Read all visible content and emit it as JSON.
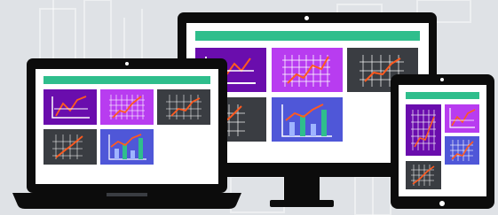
{
  "colors": {
    "background": "#dfe2e6",
    "frame": "#0c0c0c",
    "screen": "#ffffff",
    "header": "#2fbe8c",
    "tile_purple": "#6a0dad",
    "tile_magenta": "#b83cf0",
    "tile_dark": "#3a3d42",
    "tile_blue": "#4f57d8",
    "chart_line": "#ff5a1f",
    "chart_grid": "#ffffff",
    "bar_green": "#2fbe8c",
    "bar_light": "#9fb4ff"
  },
  "scene": {
    "devices": [
      "desktop-monitor",
      "laptop",
      "tablet"
    ],
    "tile_types": [
      "line-chart",
      "grid-line-chart",
      "grid-chart",
      "bar-chart"
    ]
  }
}
